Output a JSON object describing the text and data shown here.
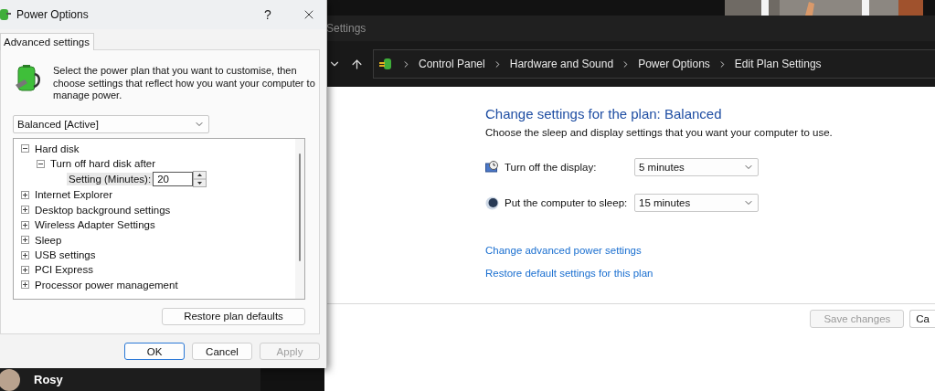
{
  "control_panel": {
    "title": "Settings",
    "breadcrumb": [
      "Control Panel",
      "Hardware and Sound",
      "Power Options",
      "Edit Plan Settings"
    ],
    "heading": "Change settings for the plan: Balanced",
    "subheading": "Choose the sleep and display settings that you want your computer to use.",
    "settings": [
      {
        "kind": "display",
        "label": "Turn off the display:",
        "value": "5 minutes"
      },
      {
        "kind": "sleep",
        "label": "Put the computer to sleep:",
        "value": "15 minutes"
      }
    ],
    "links": [
      "Change advanced power settings",
      "Restore default settings for this plan"
    ],
    "buttons": [
      {
        "label": "Save changes",
        "disabled": true
      },
      {
        "label": "Ca",
        "disabled": false
      }
    ]
  },
  "dialog": {
    "title": "Power Options",
    "help": "?",
    "tabs": [
      {
        "label": "Advanced settings",
        "selected": true
      }
    ],
    "description": "Select the power plan that you want to customise, then choose settings that reflect how you want your computer to manage power.",
    "plan": "Balanced [Active]",
    "tree": [
      {
        "label": "Hard disk",
        "expanded": true,
        "children": [
          {
            "label": "Turn off hard disk after",
            "expanded": true,
            "setting": {
              "label": "Setting (Minutes):",
              "value": "20"
            }
          }
        ]
      },
      {
        "label": "Internet Explorer",
        "expanded": false
      },
      {
        "label": "Desktop background settings",
        "expanded": false
      },
      {
        "label": "Wireless Adapter Settings",
        "expanded": false
      },
      {
        "label": "Sleep",
        "expanded": false
      },
      {
        "label": "USB settings",
        "expanded": false
      },
      {
        "label": "PCI Express",
        "expanded": false
      },
      {
        "label": "Processor power management",
        "expanded": false
      }
    ],
    "restore_button": "Restore plan defaults",
    "buttons": [
      {
        "label": "OK",
        "default": true,
        "disabled": false
      },
      {
        "label": "Cancel",
        "default": false,
        "disabled": false
      },
      {
        "label": "Apply",
        "default": false,
        "disabled": true
      }
    ]
  },
  "contact": {
    "name": "Rosy"
  }
}
